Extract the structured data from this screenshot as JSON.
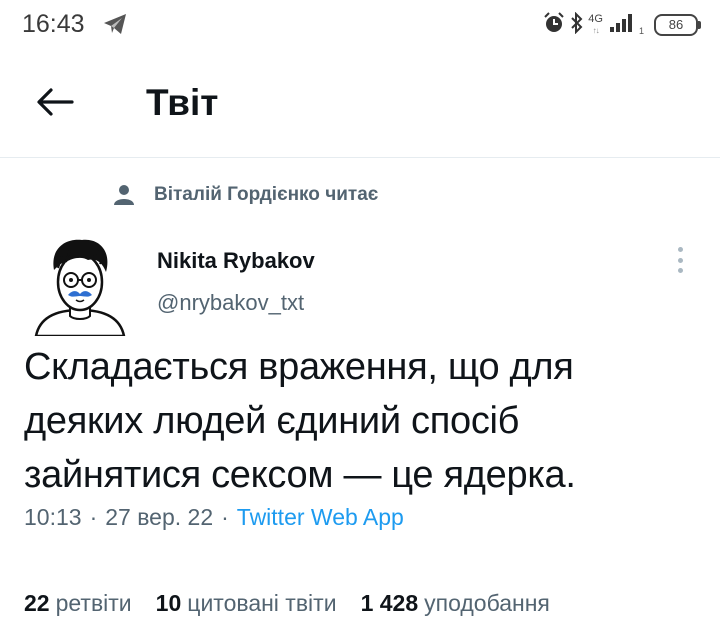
{
  "status_bar": {
    "time": "16:43",
    "network": "4G",
    "sim_slot": "1",
    "battery": "86"
  },
  "header": {
    "title": "Твіт"
  },
  "social_context": {
    "text": "Віталій Гордієнко читає"
  },
  "author": {
    "name": "Nikita Rybakov",
    "handle": "@nrybakov_txt"
  },
  "tweet": {
    "lines": [
      "Складається враження, що для",
      "деяких людей єдиний спосіб",
      "зайнятися сексом — це ядерка."
    ],
    "time": "10:13",
    "date": "27 вер. 22",
    "separator": "·",
    "source": "Twitter Web App"
  },
  "stats": {
    "retweets_count": "22",
    "retweets_label": "ретвіти",
    "quotes_count": "10",
    "quotes_label": "цитовані твіти",
    "likes_count": "1 428",
    "likes_label": "уподобання"
  },
  "colors": {
    "accent": "#1d9bf0",
    "secondary_text": "#536471",
    "primary_text": "#0f1419"
  }
}
